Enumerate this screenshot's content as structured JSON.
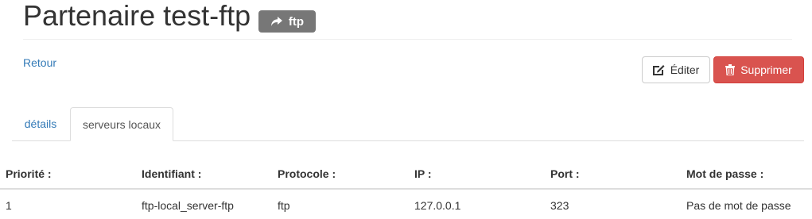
{
  "header": {
    "title": "Partenaire test-ftp",
    "badge": {
      "icon": "share-arrow-icon",
      "label": "ftp",
      "color": "#777777"
    }
  },
  "actions": {
    "back_label": "Retour",
    "edit": {
      "icon": "edit-icon",
      "label": "Éditer"
    },
    "delete": {
      "icon": "trash-icon",
      "label": "Supprimer",
      "color": "#d9534f"
    }
  },
  "tabs": [
    {
      "label": "détails",
      "active": false
    },
    {
      "label": "serveurs locaux",
      "active": true
    }
  ],
  "table": {
    "columns": [
      "Priorité :",
      "Identifiant :",
      "Protocole :",
      "IP :",
      "Port :",
      "Mot de passe :"
    ],
    "rows": [
      [
        "1",
        "ftp-local_server-ftp",
        "ftp",
        "127.0.0.1",
        "323",
        "Pas de mot de passe"
      ]
    ]
  },
  "colors": {
    "link": "#337ab7",
    "text": "#333333",
    "border": "#dddddd"
  }
}
